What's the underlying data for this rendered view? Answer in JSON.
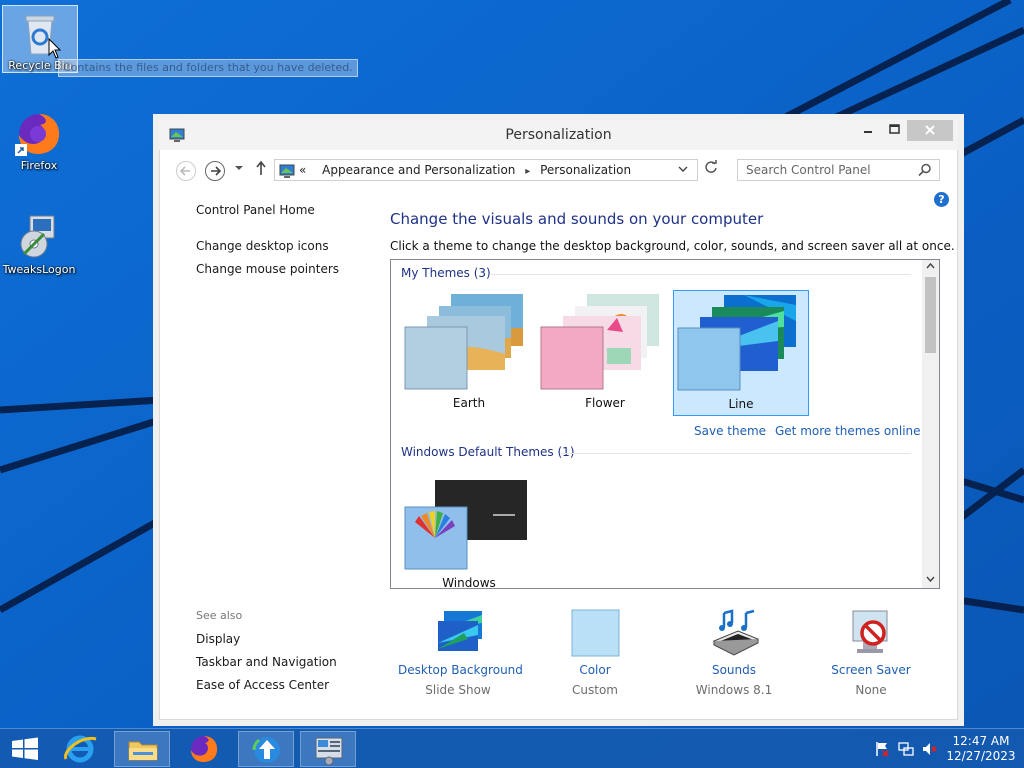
{
  "desktop": {
    "icons": [
      {
        "label": "Recycle Bin",
        "icon": "recycle-bin-icon"
      },
      {
        "label": "Firefox",
        "icon": "firefox-icon"
      },
      {
        "label": "TweaksLogon",
        "icon": "installer-disc-icon"
      }
    ],
    "tooltip": "Contains the files and folders that you have deleted."
  },
  "window": {
    "title": "Personalization",
    "address": {
      "overflow": "«",
      "crumbs": [
        "Appearance and Personalization",
        "Personalization"
      ]
    },
    "search_placeholder": "Search Control Panel",
    "help": "?"
  },
  "left_pane": {
    "home": "Control Panel Home",
    "links": [
      "Change desktop icons",
      "Change mouse pointers"
    ],
    "see_also_title": "See also",
    "see_also": [
      "Display",
      "Taskbar and Navigation",
      "Ease of Access Center"
    ]
  },
  "main": {
    "heading": "Change the visuals and sounds on your computer",
    "subheading": "Click a theme to change the desktop background, color, sounds, and screen saver all at once.",
    "groups": [
      {
        "title": "My Themes (3)",
        "themes": [
          "Earth",
          "Flower",
          "Line"
        ],
        "selected": "Line"
      },
      {
        "title": "Windows Default Themes (1)",
        "themes": [
          "Windows"
        ]
      }
    ],
    "save_theme": "Save theme",
    "get_more": "Get more themes online"
  },
  "bottom": [
    {
      "label": "Desktop Background",
      "value": "Slide Show",
      "icon": "desktop-background-icon"
    },
    {
      "label": "Color",
      "value": "Custom",
      "icon": "color-swatch-icon"
    },
    {
      "label": "Sounds",
      "value": "Windows 8.1",
      "icon": "sounds-icon"
    },
    {
      "label": "Screen Saver",
      "value": "None",
      "icon": "screen-saver-icon"
    }
  ],
  "taskbar": {
    "time": "12:47 AM",
    "date": "12/27/2023",
    "pinned": [
      "start-icon",
      "internet-explorer-icon",
      "file-explorer-icon",
      "firefox-icon",
      "update-icon",
      "control-panel-icon"
    ]
  },
  "colors": {
    "desktop": "#0a62c8",
    "link": "#1e5fb4",
    "heading": "#1e3287",
    "selection": "#cce8ff"
  }
}
